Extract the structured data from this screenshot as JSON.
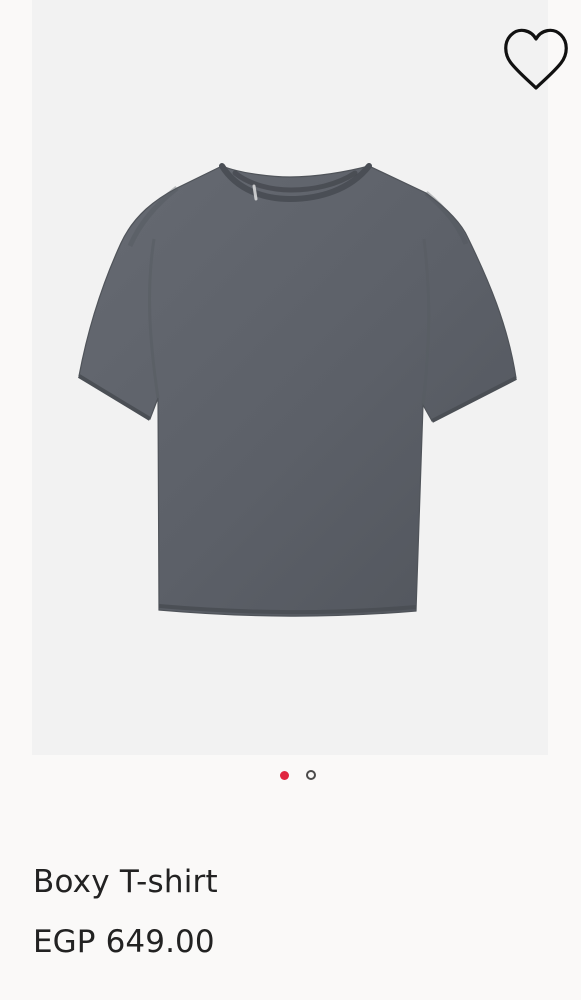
{
  "product": {
    "name": "Boxy T-shirt",
    "price": {
      "currency": "EGP",
      "amount": "649.00"
    },
    "image_description_icon": "gray-t-shirt-image"
  },
  "favorite": {
    "icon": "heart-icon"
  },
  "carousel": {
    "total_images": 2,
    "active_index": 0
  },
  "colors": {
    "background": "#faf9f8",
    "image_background": "#f2f2f2",
    "shirt": "#5c5f66",
    "active_dot": "#e0263f",
    "text": "#222222"
  }
}
